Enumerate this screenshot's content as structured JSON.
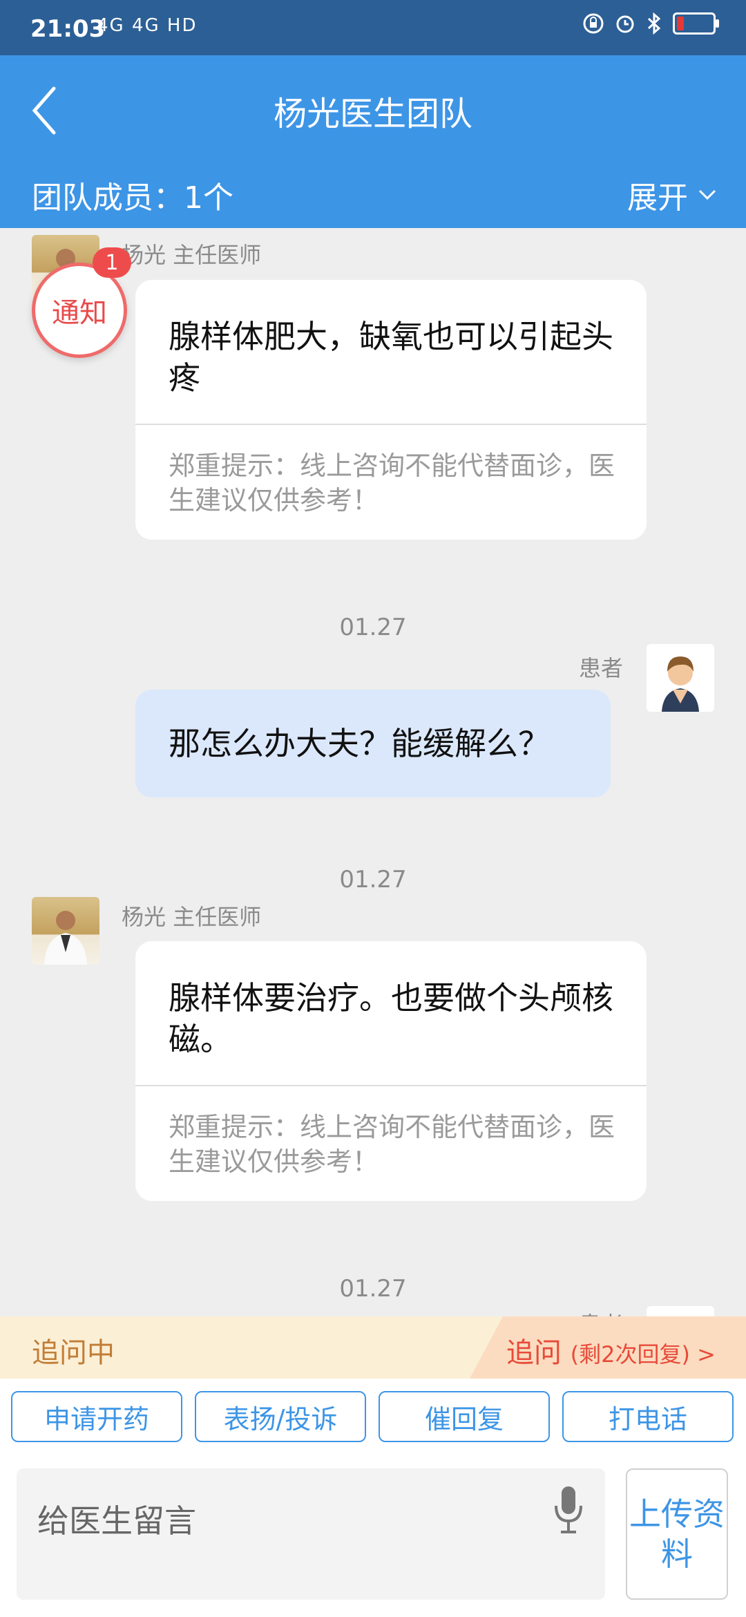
{
  "status_bar": {
    "time": "21:03",
    "network": "4G 4G HD"
  },
  "header": {
    "title": "杨光医生团队",
    "members_label": "团队成员：1个",
    "expand_label": "展开"
  },
  "notice": {
    "label": "通知",
    "count": "1"
  },
  "messages": [
    {
      "sender": "杨光 主任医师",
      "text": "腺样体肥大，缺氧也可以引起头疼",
      "tip": "郑重提示：线上咨询不能代替面诊，医生建议仅供参考！"
    },
    {
      "date": "01.27",
      "sender": "患者",
      "text": "那怎么办大夫？能缓解么？"
    },
    {
      "date": "01.27",
      "sender": "杨光 主任医师",
      "text": "腺样体要治疗。也要做个头颅核磁。",
      "tip": "郑重提示：线上咨询不能代替面诊，医生建议仅供参考！"
    },
    {
      "date": "01.27",
      "sender": "患者"
    }
  ],
  "follow_bar": {
    "left": "追问中",
    "right_main": "追问",
    "right_sub": "(剩2次回复) >"
  },
  "actions": [
    "申请开药",
    "表扬/投诉",
    "催回复",
    "打电话"
  ],
  "input": {
    "placeholder": "给医生留言",
    "upload_label": "上传资料"
  },
  "colors": {
    "header_blue": "#3d95e6",
    "status_blue": "#2c5f95",
    "notice_red": "#ee4c4c",
    "mine_bubble": "#dbe8fb"
  }
}
